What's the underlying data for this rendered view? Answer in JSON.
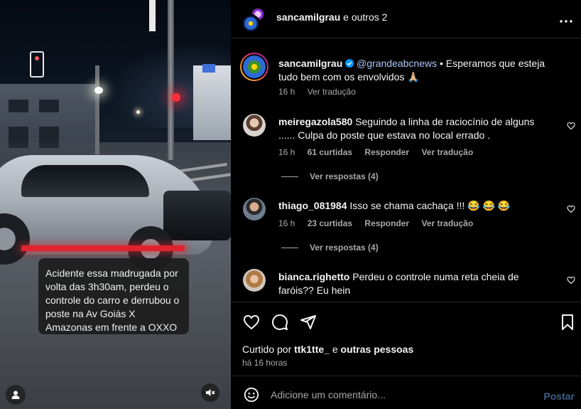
{
  "media": {
    "caption": "Acidente essa madrugada por volta das 3h30am, perdeu o controle do carro e derrubou o poste na Av Goiás X Amazonas em frente a OXXO",
    "tag_icon": "person-icon",
    "mute_icon": "speaker-muted-icon"
  },
  "header": {
    "username": "sancamilgrau",
    "collab_suffix": " e outros 2",
    "more_icon": "more-horizontal-icon"
  },
  "caption_comment": {
    "username": "sancamilgrau",
    "verified": true,
    "mention": "@grandeabcnews",
    "text": " • Esperamos que esteja tudo bem com os envolvidos 🙏🏼",
    "time": "16 h",
    "translate": "Ver tradução"
  },
  "comments": [
    {
      "username": "meiregazola580",
      "text": "Seguindo a linha de raciocínio de alguns ...... Culpa do poste que estava no local errado .",
      "time": "16 h",
      "likes": "61 curtidas",
      "reply": "Responder",
      "translate": "Ver tradução",
      "replies": "Ver respostas (4)"
    },
    {
      "username": "thiago_081984",
      "text": "Isso se chama cachaça !!! 😂 😂 😂",
      "time": "16 h",
      "likes": "23 curtidas",
      "reply": "Responder",
      "translate": "Ver tradução",
      "replies": "Ver respostas (4)"
    },
    {
      "username": "bianca.righetto",
      "text": "Perdeu o controle numa reta cheia de faróis?? Eu hein"
    }
  ],
  "actions": {
    "liked_prefix": "Curtido por ",
    "liked_user": "ttk1tte_",
    "liked_mid": " e ",
    "liked_others": "outras pessoas",
    "post_time": "há 16 horas"
  },
  "composer": {
    "placeholder": "Adicione um comentário...",
    "post_label": "Postar"
  },
  "colors": {
    "background": "#000000",
    "text": "#f5f5f5",
    "muted": "#a8a8a8",
    "link": "#a8c7fa",
    "verified": "#0095f6",
    "post_disabled": "#3d5f86"
  }
}
